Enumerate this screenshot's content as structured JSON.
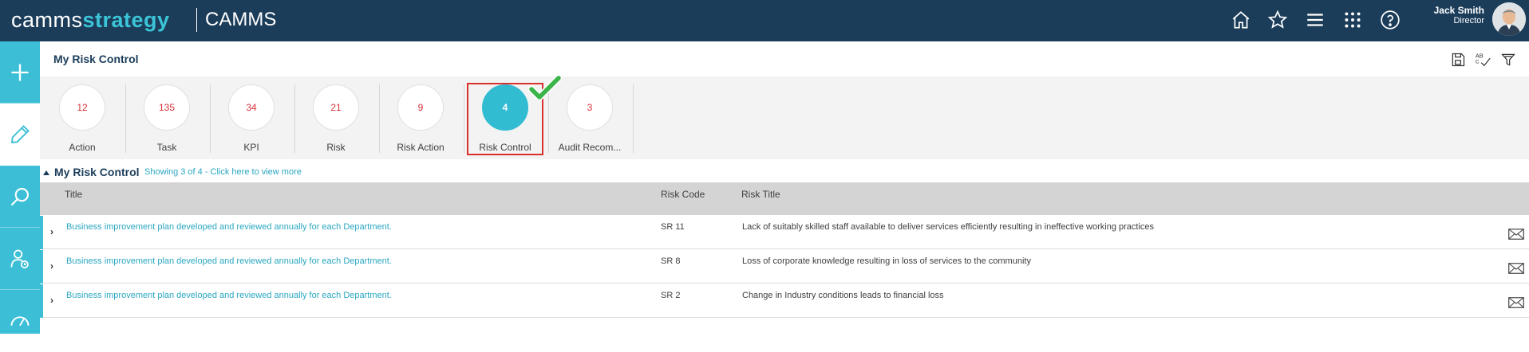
{
  "header": {
    "logo_part1": "camms",
    "logo_part2": "strategy",
    "org_name": "CAMMS",
    "user_name": "Jack Smith",
    "user_role": "Director",
    "icons": [
      "home-icon",
      "star-icon",
      "menu-icon",
      "apps-grid-icon",
      "help-icon"
    ]
  },
  "sidebar": {
    "items": [
      "add-icon",
      "pencil-icon",
      "search-icon",
      "users-icon",
      "dashboard-gauge-icon"
    ],
    "active_index": 1
  },
  "page": {
    "title": "My Risk Control",
    "tools": [
      "save-icon",
      "spellcheck-icon",
      "filter-icon"
    ]
  },
  "counters": [
    {
      "count": "12",
      "label": "Action"
    },
    {
      "count": "135",
      "label": "Task"
    },
    {
      "count": "34",
      "label": "KPI"
    },
    {
      "count": "21",
      "label": "Risk"
    },
    {
      "count": "9",
      "label": "Risk Action"
    },
    {
      "count": "4",
      "label": "Risk Control",
      "selected": true
    },
    {
      "count": "3",
      "label": "Audit Recom..."
    }
  ],
  "section": {
    "title": "My Risk Control",
    "link": "Showing 3 of 4 - Click here to view more"
  },
  "table": {
    "columns": [
      "Title",
      "Risk Code",
      "Risk Title"
    ],
    "rows": [
      {
        "title": "Business improvement plan developed and reviewed annually for each Department.",
        "code": "SR 11",
        "risk_title": "Lack of suitably skilled staff available to deliver services efficiently resulting in ineffective working practices"
      },
      {
        "title": "Business improvement plan developed and reviewed annually for each Department.",
        "code": "SR 8",
        "risk_title": "Loss of corporate knowledge resulting in loss of services to the community"
      },
      {
        "title": "Business improvement plan developed and reviewed annually for each Department.",
        "code": "SR 2",
        "risk_title": "Change in Industry conditions leads to financial loss"
      }
    ]
  },
  "colors": {
    "topbar": "#1b3d5a",
    "accent": "#3cbfd6",
    "count_text": "#d8323a",
    "selection_border": "#d9302c",
    "check": "#3bb54a"
  }
}
